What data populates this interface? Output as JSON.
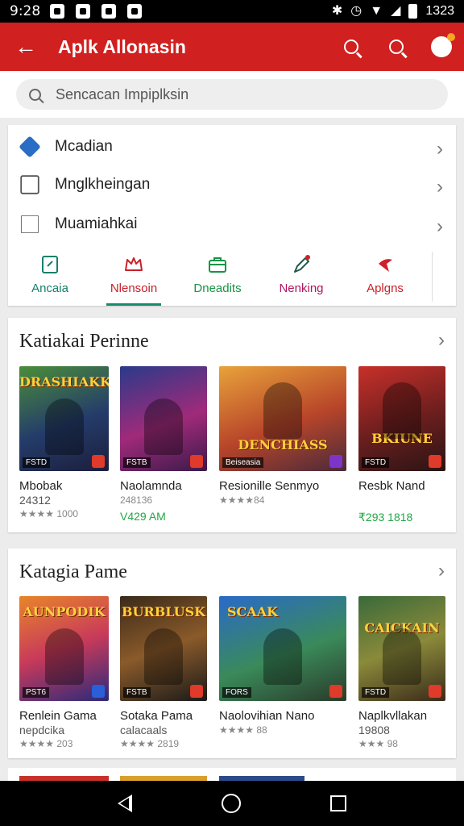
{
  "status_bar": {
    "time": "9:28",
    "right_time": "1323"
  },
  "app_bar": {
    "title": "Aplk Allonasin"
  },
  "search": {
    "placeholder": "Sencacan Impiplksin"
  },
  "menu": {
    "items": [
      {
        "label": "Mcadian",
        "icon": "diamond-icon"
      },
      {
        "label": "Mnglkheingan",
        "icon": "square-icon"
      },
      {
        "label": "Muamiahkai",
        "icon": "box-icon"
      }
    ]
  },
  "tabs": [
    {
      "label": "Ancaia",
      "color": "#16806a"
    },
    {
      "label": "Nlensoin",
      "color": "#c8202a"
    },
    {
      "label": "Dneadits",
      "color": "#179445"
    },
    {
      "label": "Nenking",
      "color": "#b0145e"
    },
    {
      "label": "Aplgns",
      "color": "#c8202a"
    }
  ],
  "sections": [
    {
      "title": "Katiakai Perinne",
      "games": [
        {
          "name": "Mbobak",
          "sub": "24312",
          "meta": "★★★★ 1000",
          "price": "",
          "brand": "FSTD",
          "logo": "DRASHIAKK",
          "badge_color": "#e03a2a"
        },
        {
          "name": "Naolamnda",
          "sub": "",
          "meta": "248136",
          "price": "V429 AM",
          "brand": "FSTB",
          "logo": "",
          "badge_color": "#e03a2a"
        },
        {
          "name": "Resionille Senmyo",
          "sub": "",
          "meta": "★★★★84",
          "price": "",
          "brand": "Beiseasia",
          "logo": "DENCHIASS",
          "badge_color": "#7d35c9"
        },
        {
          "name": "Resbk Nand",
          "sub": "",
          "meta": "",
          "price": "₹293 1818",
          "brand": "FSTD",
          "logo": "BKIUNE",
          "badge_color": "#e03a2a"
        }
      ]
    },
    {
      "title": "Katagia Pame",
      "games": [
        {
          "name": "Renlein Gama",
          "sub": "nepdcika",
          "meta": "★★★★ 203",
          "price": "",
          "brand": "PST6",
          "logo": "AUNPODIK",
          "badge_color": "#2a5fd8"
        },
        {
          "name": "Sotaka Pama",
          "sub": "calacaals",
          "meta": "★★★★ 2819",
          "price": "",
          "brand": "FSTB",
          "logo": "BURBLUSK",
          "badge_color": "#e03a2a"
        },
        {
          "name": "Naolovihian Nano",
          "sub": "",
          "meta": "★★★★ 88",
          "price": "",
          "brand": "FORS",
          "logo": "SCAAK",
          "badge_color": "#e03a2a"
        },
        {
          "name": "Naplkvllakan",
          "sub": "19808",
          "meta": "★★★ 98",
          "price": "",
          "brand": "FSTD",
          "logo": "CAICKAIN",
          "badge_color": "#e03a2a"
        }
      ]
    }
  ]
}
